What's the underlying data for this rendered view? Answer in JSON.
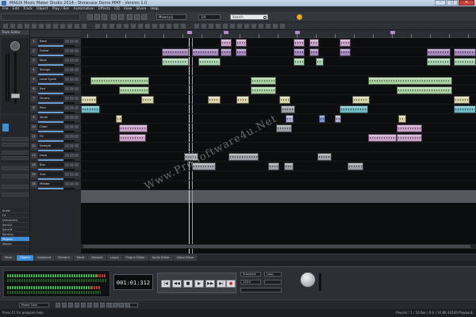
{
  "window": {
    "title": "MAGIX Music Maker Studio 2014 - Showcase Demo.MMP - Version 1.0"
  },
  "menu": [
    "File",
    "Edit",
    "Track",
    "Object",
    "Play / Rec",
    "Automation",
    "Effects",
    "CD",
    "View",
    "Share",
    "Help"
  ],
  "toolbar": {
    "project_select": "Mixed.prj",
    "preset_select": "1/4",
    "search_placeholder": "Search"
  },
  "inspector": {
    "header": "Track Editor",
    "items": [
      "Audio",
      "FX",
      "Instrument",
      "Send A",
      "Send B",
      "Routing",
      "Plugins",
      "Master"
    ],
    "selected_index": 6
  },
  "tracks": [
    {
      "num": "1",
      "name": "Bass"
    },
    {
      "num": "2",
      "name": "Guitar"
    },
    {
      "num": "3",
      "name": "Keys"
    },
    {
      "num": "4",
      "name": "Strings"
    },
    {
      "num": "5",
      "name": "Lead Synth"
    },
    {
      "num": "6",
      "name": "Pad"
    },
    {
      "num": "7",
      "name": "Drums"
    },
    {
      "num": "8",
      "name": "Perc"
    },
    {
      "num": "9",
      "name": "Vocal"
    },
    {
      "num": "10",
      "name": "Choir"
    },
    {
      "num": "11",
      "name": "FX"
    },
    {
      "num": "12",
      "name": "Sample"
    },
    {
      "num": "13",
      "name": "Loop"
    },
    {
      "num": "14",
      "name": "Bus"
    },
    {
      "num": "15",
      "name": "Aux"
    },
    {
      "num": "16",
      "name": "Master"
    }
  ],
  "bottom_tabs": [
    "Mixer",
    "Objects",
    "Keyboard",
    "Markers",
    "Takes",
    "Browser",
    "Loops",
    "Plug-in Editor",
    "Audio Editor",
    "Video Editor"
  ],
  "bottom_tabs_active": 1,
  "transport": {
    "time": "001:01:312",
    "rec_select": "Standard",
    "loop_select": "Loop",
    "tempo_select": "120.0",
    "record_label": "●",
    "play_label": "▶",
    "stop_label": "■",
    "rewind_label": "◀◀",
    "forward_label": "▶▶",
    "start_label": "|◀",
    "end_label": "▶|"
  },
  "bottombar": {
    "mode_select": "Power User",
    "position": "000:00:578"
  },
  "status": {
    "left": "Press F1 for program help",
    "right": "Playlist / 1 / 16 Bar | 0:0 | 16 Bit 44100 Playback"
  },
  "watermark": "Www.ProSoftware4u.Net",
  "colors": {
    "accent": "#3c8ed8",
    "clip_purple": "#a487bd",
    "clip_mint": "#a6d0b0",
    "clip_teal": "#6fb7c0",
    "clip_beige": "#d7d3a6",
    "record": "#d12a22"
  },
  "icons": [
    "app-icon",
    "search-icon",
    "help-icon",
    "close-icon",
    "maximize-icon",
    "minimize-icon",
    "master-knob-icon"
  ]
}
